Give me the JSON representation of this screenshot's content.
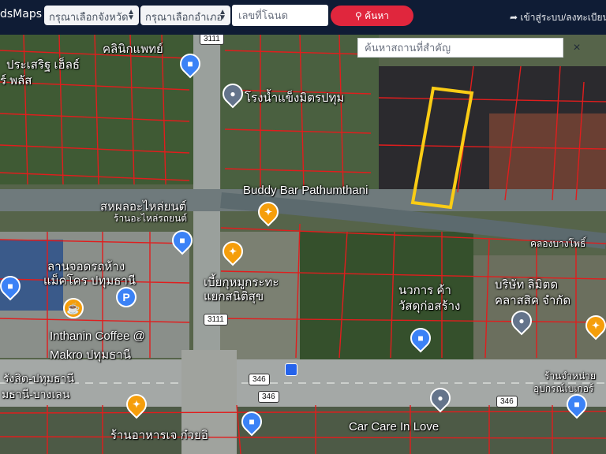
{
  "header": {
    "brand": "dsMaps",
    "province_select": "กรุณาเลือกจังหวัด",
    "district_select": "กรุณาเลือกอำเภอ",
    "deed_placeholder": "เลขที่โฉนด",
    "search_button": "ค้นหา",
    "login_link": "เข้าสู่ระบบ/ลงทะเบียน"
  },
  "map": {
    "place_search_placeholder": "ค้นหาสถานที่สำคัญ",
    "close_symbol": "×",
    "labels": {
      "l1": "คลินิกแพทย์",
      "l2": "ประเสริฐ เฮ็ลธ์",
      "l3": "ร์ พลัส",
      "l4": "โรงน้ำแข็งมิตรปทุม",
      "l5": "Buddy Bar Pathumthani",
      "l6": "สหผลอะไหล่ยนต์",
      "l7": "ร้านอะไหล่รถยนต์",
      "l8": "ลานจอดรถห้าง",
      "l9": "แม็คโคร ปทุมธานี",
      "l10": "เบี้ยกุหมูกระทะ",
      "l11": "แยกสนิติสุข",
      "l12": "นวการ ค้า",
      "l13": "วัสดุก่อสร้าง",
      "l14": "บริษัท ลิมิตด",
      "l15": "คลาสสิค จำกัด",
      "l16": "Inthanin Coffee @",
      "l17": "Makro ปทุมธานี",
      "l18": "รังสิต-ปทุมธานี",
      "l19": "มธานี-บางเลน",
      "l20": "คลองบางโพธิ์",
      "l21": "Car Care In Love",
      "l22": "ร้านอาหารเจ ก๋วยอิ",
      "l23": "ร้านจำหน่าย",
      "l24": "อุปกรณ์เบเกอร์"
    },
    "road_shields": {
      "r3111a": "3111",
      "r3111b": "3111",
      "r346a": "346",
      "r346b": "346",
      "r346c": "346"
    }
  },
  "colors": {
    "header_bg": "#0f1c35",
    "search_button": "#e0263d",
    "parcel_lines": "#e11d1d",
    "highlight_parcel": "#facc15"
  }
}
